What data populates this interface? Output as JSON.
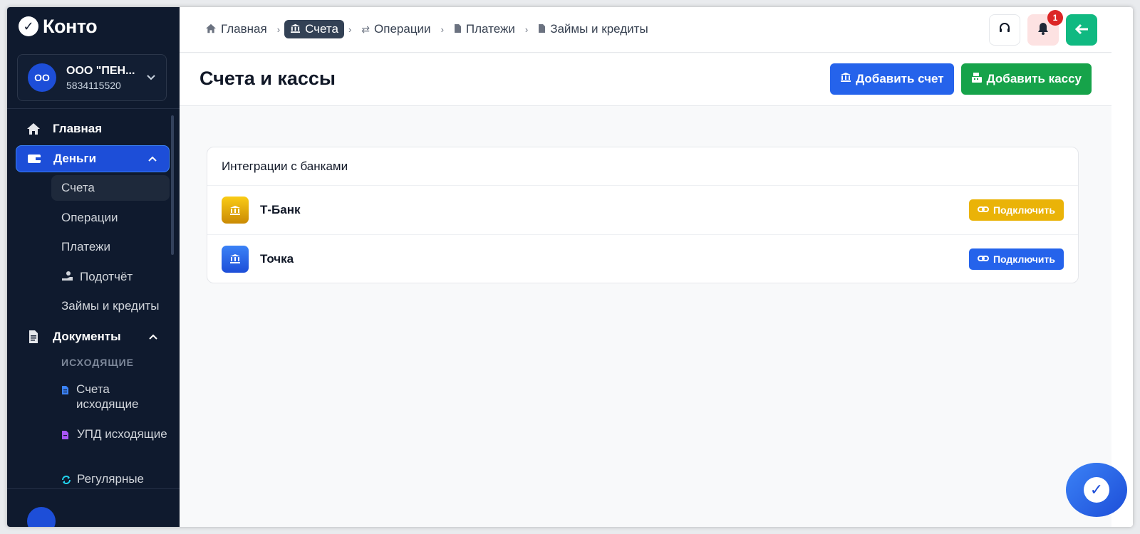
{
  "brand": {
    "name": "Конто",
    "logo_icon": "check-circle-icon"
  },
  "org": {
    "initials": "ОО",
    "name": "ООО \"ПЕН...",
    "inn": "5834115520"
  },
  "nav": {
    "home": "Главная",
    "money": "Деньги",
    "money_sub": [
      "Счета",
      "Операции",
      "Платежи",
      "Подотчёт",
      "Займы и кредиты"
    ],
    "documents": "Документы",
    "outgoing_label": "ИСХОДЯЩИЕ",
    "docs": [
      {
        "label": "Счета исходящие",
        "color": "#3b82f6"
      },
      {
        "label": "УПД исходящие",
        "color": "#a855f7"
      },
      {
        "label": "Регулярные",
        "color": "#22d3ee"
      }
    ]
  },
  "breadcrumbs": [
    {
      "label": "Главная",
      "icon": "home-icon",
      "current": false
    },
    {
      "label": "Счета",
      "icon": "bank-icon",
      "current": true
    },
    {
      "label": "Операции",
      "icon": "arrows-exchange-icon",
      "current": false
    },
    {
      "label": "Платежи",
      "icon": "document-icon",
      "current": false
    },
    {
      "label": "Займы и кредиты",
      "icon": "document-icon",
      "current": false
    }
  ],
  "notifications": {
    "count": "1"
  },
  "page": {
    "title": "Счета и кассы",
    "add_account": "Добавить счет",
    "add_cashbox": "Добавить кассу"
  },
  "integrations": {
    "title": "Интеграции с банками",
    "banks": [
      {
        "name": "Т-Банк",
        "action": "Подключить",
        "color": "#eab308"
      },
      {
        "name": "Точка",
        "action": "Подключить",
        "color": "#2563eb"
      }
    ]
  },
  "colors": {
    "sidebar_bg": "#0f1a2e",
    "accent": "#2563eb",
    "success": "#16a34a",
    "logout": "#10b981"
  }
}
